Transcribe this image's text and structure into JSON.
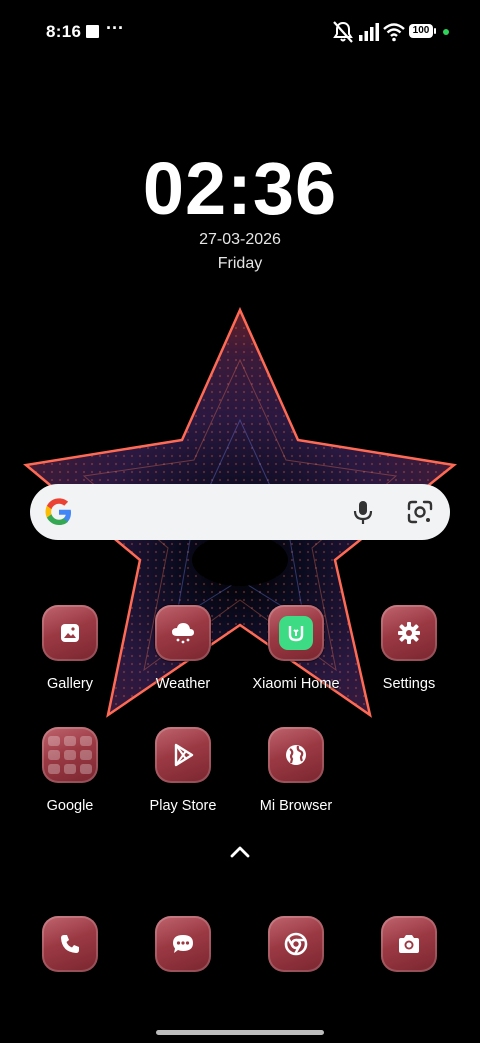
{
  "status_bar": {
    "time": "8:16",
    "overflow": "···",
    "battery": "100",
    "icons": [
      "notifications-muted-icon",
      "signal-icon",
      "wifi-icon",
      "battery-icon"
    ]
  },
  "lock_clock": {
    "time": "02:36",
    "date": "27-03-2026",
    "day": "Friday"
  },
  "search": {
    "icons": [
      "google-logo-icon",
      "microphone-icon",
      "google-lens-icon"
    ]
  },
  "apps": {
    "row1": [
      {
        "label": "Gallery",
        "icon": "gallery-icon"
      },
      {
        "label": "Weather",
        "icon": "weather-icon"
      },
      {
        "label": "Xiaomi Home",
        "icon": "xiaomi-home-icon"
      },
      {
        "label": "Settings",
        "icon": "settings-icon"
      }
    ],
    "row2": [
      {
        "label": "Google",
        "icon": "google-folder-icon"
      },
      {
        "label": "Play Store",
        "icon": "play-store-icon"
      },
      {
        "label": "Mi Browser",
        "icon": "globe-icon"
      }
    ]
  },
  "dock": [
    {
      "icon": "phone-icon"
    },
    {
      "icon": "messages-icon"
    },
    {
      "icon": "chrome-icon"
    },
    {
      "icon": "camera-icon"
    }
  ],
  "colors": {
    "icon_bg": "#9b3943",
    "xiaomi_green": "#3ddc84",
    "star_glow": "#ff5a4a"
  }
}
